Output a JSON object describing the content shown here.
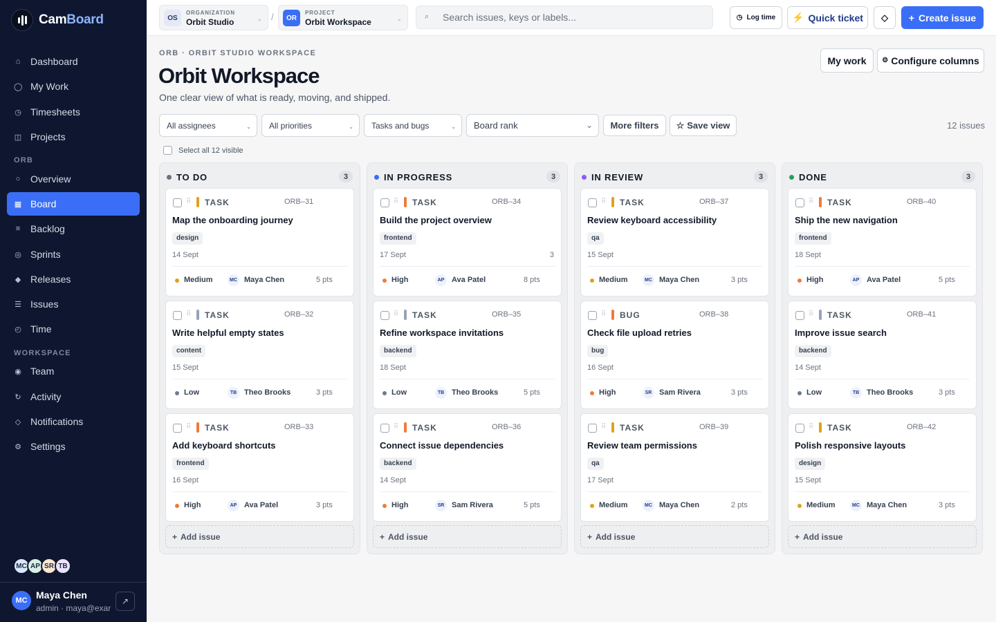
{
  "brand": {
    "name_a": "Cam",
    "name_b": "Board"
  },
  "sidebar": {
    "main_items": [
      {
        "label": "Dashboard",
        "icon": "home-icon"
      },
      {
        "label": "My Work",
        "icon": "circle-icon"
      },
      {
        "label": "Timesheets",
        "icon": "clock-icon"
      },
      {
        "label": "Projects",
        "icon": "folder-icon"
      }
    ],
    "section_orb": "ORB",
    "orb_items": [
      {
        "label": "Overview",
        "icon": "dot-icon"
      },
      {
        "label": "Board",
        "icon": "grid-icon"
      },
      {
        "label": "Backlog",
        "icon": "list-icon"
      },
      {
        "label": "Sprints",
        "icon": "cycle-icon"
      },
      {
        "label": "Releases",
        "icon": "diamond-icon"
      },
      {
        "label": "Issues",
        "icon": "lines-icon"
      },
      {
        "label": "Time",
        "icon": "timer-icon"
      }
    ],
    "section_workspace": "WORKSPACE",
    "workspace_items": [
      {
        "label": "Team",
        "icon": "target-icon"
      },
      {
        "label": "Activity",
        "icon": "refresh-icon"
      },
      {
        "label": "Notifications",
        "icon": "bell-icon"
      },
      {
        "label": "Settings",
        "icon": "gear-icon"
      }
    ],
    "members": [
      "MC",
      "AP",
      "SR",
      "TB"
    ],
    "user": {
      "initials": "MC",
      "name": "Maya Chen",
      "sub": "admin · maya@example.com"
    }
  },
  "topbar": {
    "org": {
      "badge": "OS",
      "label": "ORGANIZATION",
      "value": "Orbit Studio"
    },
    "project": {
      "badge": "OR",
      "label": "PROJECT",
      "value": "Orbit Workspace"
    },
    "search_placeholder": "Search issues, keys or labels...",
    "log_time": "Log time",
    "quick_ticket": "Quick ticket",
    "create_issue": "Create issue"
  },
  "page": {
    "crumb": "ORB · ORBIT STUDIO WORKSPACE",
    "title": "Orbit Workspace",
    "subtitle": "One clear view of what is ready, moving, and shipped.",
    "my_work": "My work",
    "configure": "Configure columns"
  },
  "filters": {
    "assignees": "All assignees",
    "priorities": "All priorities",
    "types": "Tasks and bugs",
    "sort": "Board rank",
    "more": "More filters",
    "save": "Save view",
    "count": "12 issues",
    "select_all": "Select all 12 visible"
  },
  "add_issue": "Add issue",
  "colors": {
    "accent": "#3b6ef6",
    "todo": "#6b7280",
    "progress": "#3b6ef6",
    "review": "#8b5cf6",
    "done": "#22a35a",
    "high": "#f07a3a",
    "medium": "#e0a21b",
    "low": "#6b7c93"
  },
  "columns": [
    {
      "title": "TO DO",
      "count": "3",
      "color": "#6b7280",
      "cards": [
        {
          "type": "TASK",
          "key": "ORB–31",
          "bar": "#e0a21b",
          "title": "Map the onboarding journey",
          "tag": "design",
          "date": "14 Sept",
          "extra": "",
          "priority": "Medium",
          "pcolor": "#e0a21b",
          "av": "MC",
          "assignee": "Maya Chen",
          "pts": "5 pts"
        },
        {
          "type": "TASK",
          "key": "ORB–32",
          "bar": "#94a3b8",
          "title": "Write helpful empty states",
          "tag": "content",
          "date": "15 Sept",
          "extra": "",
          "priority": "Low",
          "pcolor": "#6b7c93",
          "av": "TB",
          "assignee": "Theo Brooks",
          "pts": "3 pts"
        },
        {
          "type": "TASK",
          "key": "ORB–33",
          "bar": "#f07a3a",
          "title": "Add keyboard shortcuts",
          "tag": "frontend",
          "date": "16 Sept",
          "extra": "",
          "priority": "High",
          "pcolor": "#f07a3a",
          "av": "AP",
          "assignee": "Ava Patel",
          "pts": "3 pts"
        }
      ]
    },
    {
      "title": "IN PROGRESS",
      "count": "3",
      "color": "#3b6ef6",
      "cards": [
        {
          "type": "TASK",
          "key": "ORB–34",
          "bar": "#f07a3a",
          "title": "Build the project overview",
          "tag": "frontend",
          "date": "17 Sept",
          "extra": "3",
          "priority": "High",
          "pcolor": "#f07a3a",
          "av": "AP",
          "assignee": "Ava Patel",
          "pts": "8 pts"
        },
        {
          "type": "TASK",
          "key": "ORB–35",
          "bar": "#94a3b8",
          "title": "Refine workspace invitations",
          "tag": "backend",
          "date": "18 Sept",
          "extra": "",
          "priority": "Low",
          "pcolor": "#6b7c93",
          "av": "TB",
          "assignee": "Theo Brooks",
          "pts": "5 pts"
        },
        {
          "type": "TASK",
          "key": "ORB–36",
          "bar": "#f07a3a",
          "title": "Connect issue dependencies",
          "tag": "backend",
          "date": "14 Sept",
          "extra": "",
          "priority": "High",
          "pcolor": "#f07a3a",
          "av": "SR",
          "assignee": "Sam Rivera",
          "pts": "5 pts"
        }
      ]
    },
    {
      "title": "IN REVIEW",
      "count": "3",
      "color": "#8b5cf6",
      "cards": [
        {
          "type": "TASK",
          "key": "ORB–37",
          "bar": "#e0a21b",
          "title": "Review keyboard accessibility",
          "tag": "qa",
          "date": "15 Sept",
          "extra": "",
          "priority": "Medium",
          "pcolor": "#e0a21b",
          "av": "MC",
          "assignee": "Maya Chen",
          "pts": "3 pts"
        },
        {
          "type": "BUG",
          "key": "ORB–38",
          "bar": "#f07a3a",
          "title": "Check file upload retries",
          "tag": "bug",
          "date": "16 Sept",
          "extra": "",
          "priority": "High",
          "pcolor": "#f07a3a",
          "av": "SR",
          "assignee": "Sam Rivera",
          "pts": "3 pts"
        },
        {
          "type": "TASK",
          "key": "ORB–39",
          "bar": "#e0a21b",
          "title": "Review team permissions",
          "tag": "qa",
          "date": "17 Sept",
          "extra": "",
          "priority": "Medium",
          "pcolor": "#e0a21b",
          "av": "MC",
          "assignee": "Maya Chen",
          "pts": "2 pts"
        }
      ]
    },
    {
      "title": "DONE",
      "count": "3",
      "color": "#22a35a",
      "cards": [
        {
          "type": "TASK",
          "key": "ORB–40",
          "bar": "#f07a3a",
          "title": "Ship the new navigation",
          "tag": "frontend",
          "date": "18 Sept",
          "extra": "",
          "priority": "High",
          "pcolor": "#f07a3a",
          "av": "AP",
          "assignee": "Ava Patel",
          "pts": "5 pts"
        },
        {
          "type": "TASK",
          "key": "ORB–41",
          "bar": "#94a3b8",
          "title": "Improve issue search",
          "tag": "backend",
          "date": "14 Sept",
          "extra": "",
          "priority": "Low",
          "pcolor": "#6b7c93",
          "av": "TB",
          "assignee": "Theo Brooks",
          "pts": "3 pts"
        },
        {
          "type": "TASK",
          "key": "ORB–42",
          "bar": "#e0a21b",
          "title": "Polish responsive layouts",
          "tag": "design",
          "date": "15 Sept",
          "extra": "",
          "priority": "Medium",
          "pcolor": "#e0a21b",
          "av": "MC",
          "assignee": "Maya Chen",
          "pts": "3 pts"
        }
      ]
    }
  ]
}
